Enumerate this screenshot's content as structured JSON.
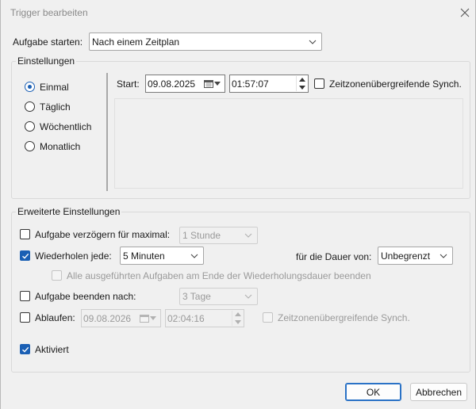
{
  "window": {
    "title": "Trigger bearbeiten"
  },
  "task_start": {
    "label": "Aufgabe starten:",
    "value": "Nach einem Zeitplan"
  },
  "settings": {
    "title": "Einstellungen",
    "options": [
      {
        "label": "Einmal",
        "selected": true
      },
      {
        "label": "Täglich",
        "selected": false
      },
      {
        "label": "Wöchentlich",
        "selected": false
      },
      {
        "label": "Monatlich",
        "selected": false
      }
    ],
    "start_label": "Start:",
    "start_date": "09.08.2025",
    "start_time": "01:57:07",
    "sync_label": "Zeitzonenübergreifende Synch.",
    "sync_checked": false
  },
  "advanced": {
    "title": "Erweiterte Einstellungen",
    "delay": {
      "label": "Aufgabe verzögern für maximal:",
      "checked": false,
      "value": "1 Stunde"
    },
    "repeat": {
      "label": "Wiederholen jede:",
      "checked": true,
      "value": "5 Minuten",
      "duration_label": "für die Dauer von:",
      "duration_value": "Unbegrenzt"
    },
    "stop_all": {
      "label": "Alle ausgeführten Aufgaben am Ende der Wiederholungsdauer beenden",
      "checked": false
    },
    "stop_after": {
      "label": "Aufgabe beenden nach:",
      "checked": false,
      "value": "3 Tage"
    },
    "expire": {
      "label": "Ablaufen:",
      "checked": false,
      "date": "09.08.2026",
      "time": "02:04:16",
      "sync_label": "Zeitzonenübergreifende Synch.",
      "sync_checked": false
    },
    "enabled": {
      "label": "Aktiviert",
      "checked": true
    }
  },
  "buttons": {
    "ok": "OK",
    "cancel": "Abbrechen"
  },
  "colors": {
    "accent": "#1a5fb4",
    "background": "#f0f0f0"
  }
}
